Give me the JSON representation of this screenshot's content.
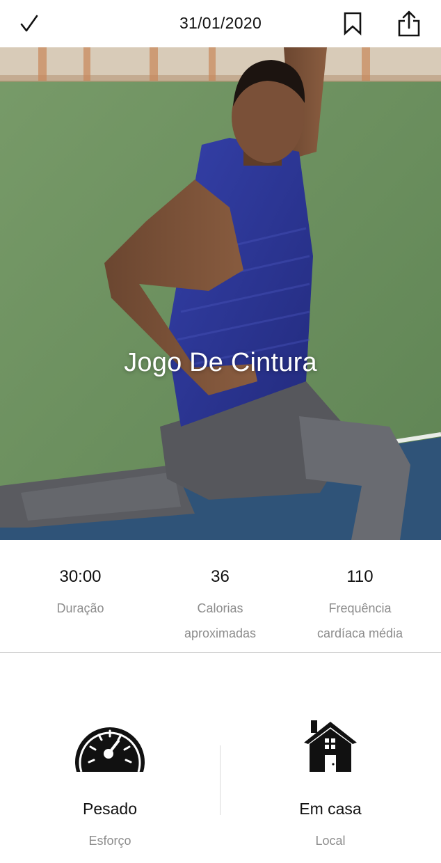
{
  "header": {
    "date": "31/01/2020",
    "check_icon": "checkmark-icon",
    "bookmark_icon": "bookmark-icon",
    "share_icon": "share-icon"
  },
  "hero": {
    "title": "Jogo De Cintura",
    "image": "athlete-lunge-photo"
  },
  "stats": [
    {
      "value": "30:00",
      "label": "Duração"
    },
    {
      "value": "36",
      "label": "Calorias aproximadas"
    },
    {
      "value": "110",
      "label": "Frequência cardíaca média"
    }
  ],
  "details": [
    {
      "icon": "speedometer-icon",
      "title": "Pesado",
      "subtitle": "Esforço"
    },
    {
      "icon": "house-icon",
      "title": "Em casa",
      "subtitle": "Local"
    }
  ],
  "colors": {
    "background": "#ffffff",
    "text_primary": "#111111",
    "text_secondary": "#8c8c8c",
    "divider": "#d4d4d4",
    "court_green": "#6e9160",
    "court_blue": "#2f5378",
    "shirt_blue": "#2c3596"
  }
}
